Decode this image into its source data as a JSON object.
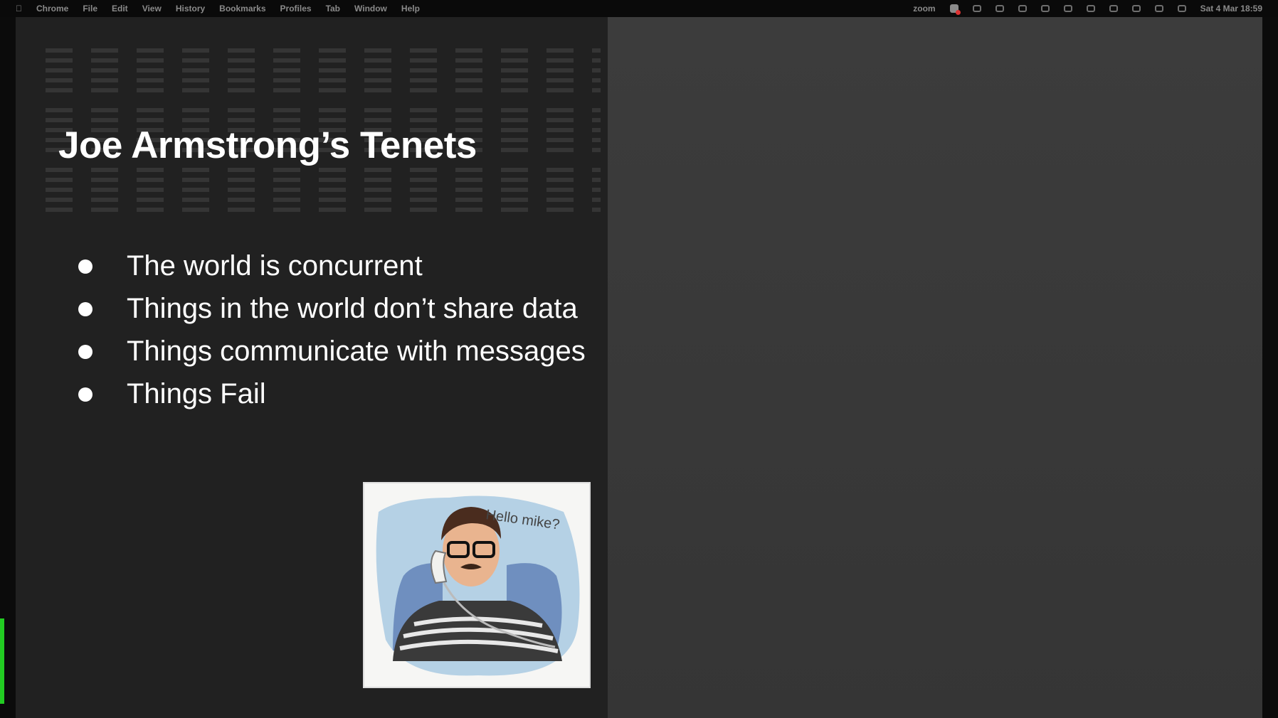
{
  "menubar": {
    "apple": "",
    "menus": [
      "Chrome",
      "File",
      "Edit",
      "View",
      "History",
      "Bookmarks",
      "Profiles",
      "Tab",
      "Window",
      "Help"
    ],
    "zoom_label": "zoom",
    "clock": "Sat 4 Mar 18:59"
  },
  "slide": {
    "title": "Joe Armstrong’s Tenets",
    "bullets": [
      "The world is concurrent",
      "Things in the world don’t share data",
      "Things communicate with messages",
      "Things Fail"
    ],
    "illustration": {
      "speech_text": "Hello mike?"
    }
  },
  "diagram": {
    "actors": [
      {
        "kind": "rabbit-icon"
      },
      {
        "kind": "rabbit-icon"
      },
      {
        "kind": "rabbit-icon"
      },
      {
        "kind": "rabbit-icon"
      },
      {
        "kind": "wolf-icon"
      },
      {
        "kind": "wolf-icon"
      }
    ],
    "bus": "bus-icon",
    "colors": {
      "bus": "#d9231f",
      "actor_ring": "#bcd8ec"
    }
  }
}
